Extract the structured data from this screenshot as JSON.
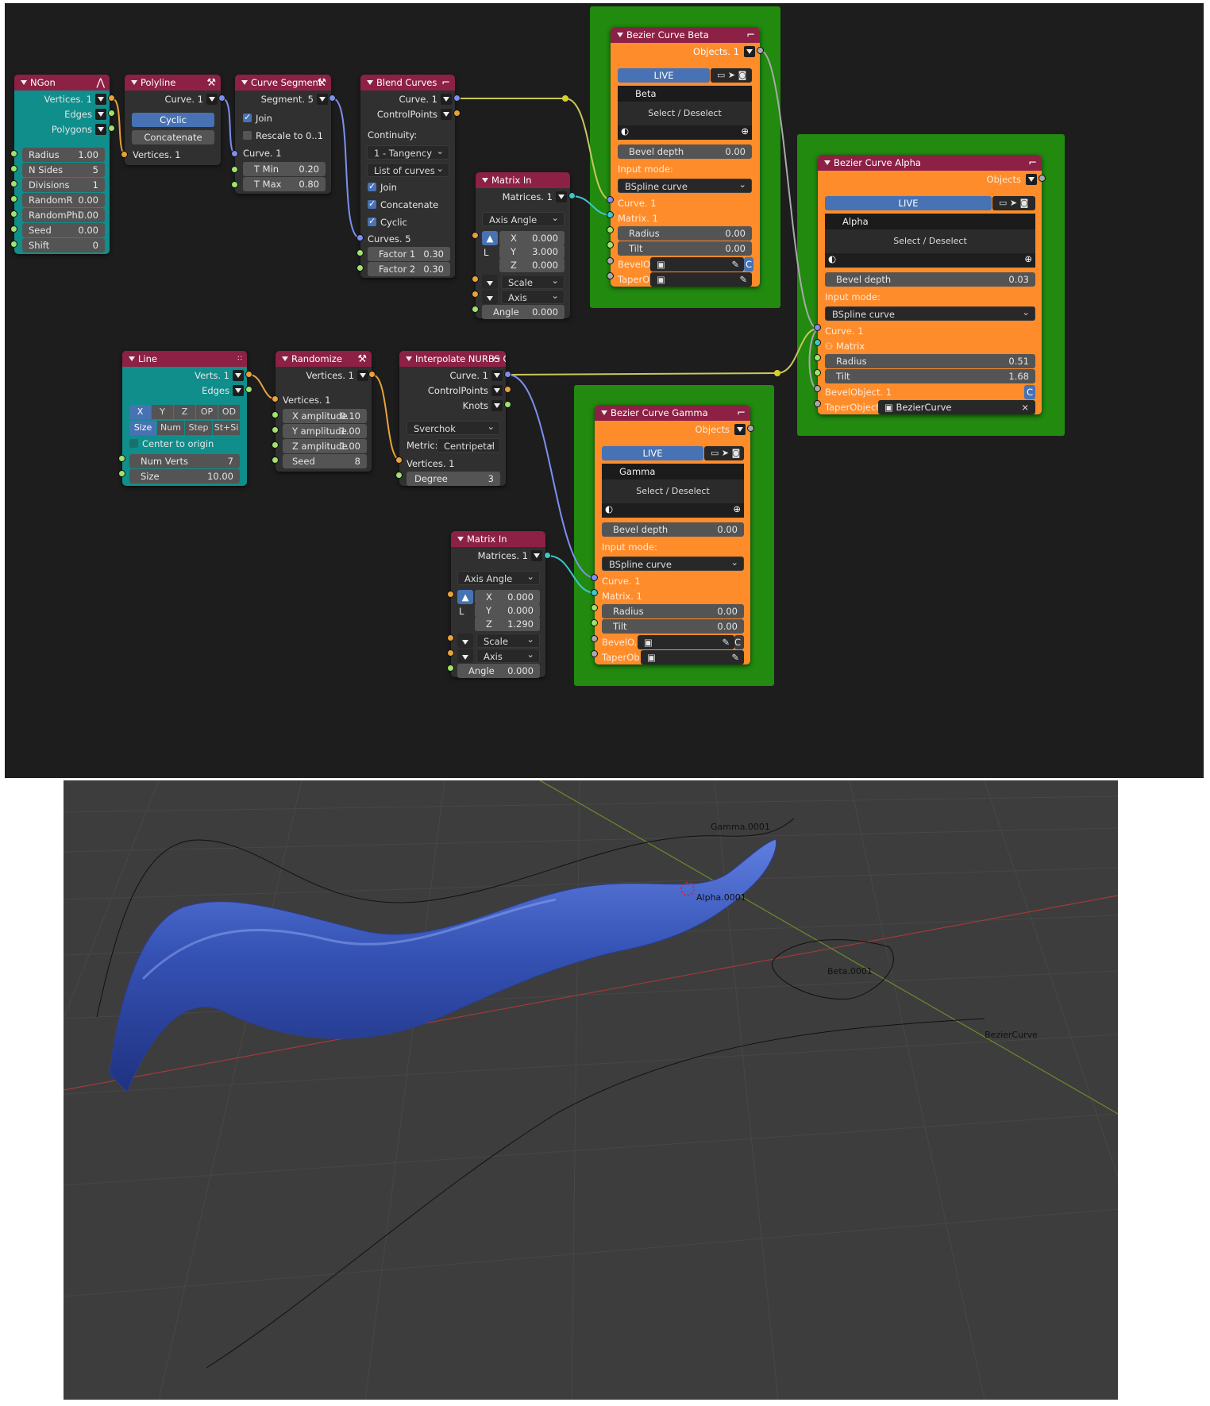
{
  "window": {
    "editor": "Sverchok node editor",
    "viewport": "3D Viewport"
  },
  "colors": {
    "editor_bg": "#1d1d1d",
    "node_header": "#8c2145",
    "teal_node": "#0f8e8c",
    "orange_node": "#ff8c2a",
    "frame_green": "#218a0f",
    "accent_blue": "#4772b3",
    "mesh_blue": "#3552b5"
  },
  "ngon": {
    "title": "NGon",
    "out_vertices": "Vertices. 1",
    "out_edges": "Edges",
    "out_polygons": "Polygons",
    "radius": "Radius",
    "radius_v": "1.00",
    "nsides": "N Sides",
    "nsides_v": "5",
    "divisions": "Divisions",
    "divisions_v": "1",
    "randomr": "RandomR",
    "randomr_v": "0.00",
    "randomphi": "RandomPhi",
    "randomphi_v": "0.00",
    "seed": "Seed",
    "seed_v": "0.00",
    "shift": "Shift",
    "shift_v": "0"
  },
  "polyline": {
    "title": "Polyline",
    "out_curve": "Curve. 1",
    "cyclic": "Cyclic",
    "concatenate": "Concatenate",
    "in_vertices": "Vertices. 1"
  },
  "segment": {
    "title": "Curve Segment",
    "out_segment": "Segment. 5",
    "join": "Join",
    "rescale": "Rescale to 0..1",
    "in_curve": "Curve. 1",
    "tmin": "T Min",
    "tmin_v": "0.20",
    "tmax": "T Max",
    "tmax_v": "0.80"
  },
  "blend": {
    "title": "Blend Curves",
    "out_curve": "Curve. 1",
    "out_cp": "ControlPoints",
    "continuity": "Continuity:",
    "continuity_v": "1 - Tangency",
    "mode": "List of curves",
    "join": "Join",
    "concatenate": "Concatenate",
    "cyclic": "Cyclic",
    "in_curves": "Curves. 5",
    "factor1": "Factor 1",
    "factor1_v": "0.30",
    "factor2": "Factor 2",
    "factor2_v": "0.30"
  },
  "matrix1": {
    "title": "Matrix In",
    "out": "Matrices. 1",
    "mode": "Axis Angle",
    "l": "L",
    "x": "X",
    "x_v": "0.000",
    "y": "Y",
    "y_v": "3.000",
    "z": "Z",
    "z_v": "0.000",
    "scale": "Scale",
    "axis": "Axis",
    "angle": "Angle",
    "angle_v": "0.000"
  },
  "beta": {
    "title": "Bezier Curve Beta",
    "objects": "Objects. 1",
    "live": "LIVE",
    "obj": "Beta",
    "select": "Select / Deselect",
    "bevel": "Bevel depth",
    "bevel_v": "0.00",
    "input_mode": "Input mode:",
    "mode": "BSpline curve",
    "curve": "Curve. 1",
    "matrix": "Matrix. 1",
    "radius": "Radius",
    "radius_v": "0.00",
    "tilt": "Tilt",
    "tilt_v": "0.00",
    "bevel_obj": "BevelO..",
    "taper_obj": "TaperO..",
    "c": "C"
  },
  "alpha": {
    "title": "Bezier Curve Alpha",
    "objects": "Objects",
    "live": "LIVE",
    "obj": "Alpha",
    "select": "Select / Deselect",
    "bevel": "Bevel depth",
    "bevel_v": "0.03",
    "input_mode": "Input mode:",
    "mode": "BSpline curve",
    "curve": "Curve. 1",
    "matrix": "Matrix",
    "radius": "Radius",
    "radius_v": "0.51",
    "tilt": "Tilt",
    "tilt_v": "1.68",
    "bevel_obj": "BevelObject. 1",
    "taper_obj": "TaperObject",
    "taper_v": "BezierCurve",
    "c": "C",
    "x": "×"
  },
  "line": {
    "title": "Line",
    "out_verts": "Verts. 1",
    "out_edges": "Edges",
    "tabs": [
      "X",
      "Y",
      "Z",
      "OP",
      "OD"
    ],
    "tabs2": [
      "Size",
      "Num",
      "Step",
      "St+Si"
    ],
    "center": "Center to origin",
    "numverts": "Num Verts",
    "numverts_v": "7",
    "size": "Size",
    "size_v": "10.00"
  },
  "randomize": {
    "title": "Randomize",
    "out": "Vertices. 1",
    "in": "Vertices. 1",
    "xa": "X amplitude",
    "xa_v": "0.10",
    "ya": "Y amplitude",
    "ya_v": "1.00",
    "za": "Z amplitude",
    "za_v": "1.00",
    "seed": "Seed",
    "seed_v": "8"
  },
  "nurbs": {
    "title": "Interpolate NURBS C...",
    "out_curve": "Curve. 1",
    "out_cp": "ControlPoints",
    "out_knots": "Knots",
    "impl": "Sverchok",
    "metric": "Metric:",
    "metric_v": "Centripetal",
    "in_vertices": "Vertices. 1",
    "degree": "Degree",
    "degree_v": "3"
  },
  "matrix2": {
    "title": "Matrix In",
    "out": "Matrices. 1",
    "mode": "Axis Angle",
    "l": "L",
    "x": "X",
    "x_v": "0.000",
    "y": "Y",
    "y_v": "0.000",
    "z": "Z",
    "z_v": "1.290",
    "scale": "Scale",
    "axis": "Axis",
    "angle": "Angle",
    "angle_v": "0.000"
  },
  "gamma": {
    "title": "Bezier Curve Gamma",
    "objects": "Objects",
    "live": "LIVE",
    "obj": "Gamma",
    "select": "Select / Deselect",
    "bevel": "Bevel depth",
    "bevel_v": "0.00",
    "input_mode": "Input mode:",
    "mode": "BSpline curve",
    "curve": "Curve. 1",
    "matrix": "Matrix. 1",
    "radius": "Radius",
    "radius_v": "0.00",
    "tilt": "Tilt",
    "tilt_v": "0.00",
    "bevel_obj": "BevelO..",
    "taper_obj": "TaperOb..",
    "c": "C"
  },
  "viewport": {
    "gamma": "Gamma.0001",
    "alpha": "Alpha.0001",
    "beta": "Beta.0001",
    "bezier": "BezierCurve"
  },
  "icons": [
    "curve-icon",
    "tool-icon",
    "bezier-icon",
    "camera-icon",
    "cursor-icon",
    "monitor-icon",
    "eyedropper-icon",
    "plus-icon",
    "sphere-icon"
  ]
}
